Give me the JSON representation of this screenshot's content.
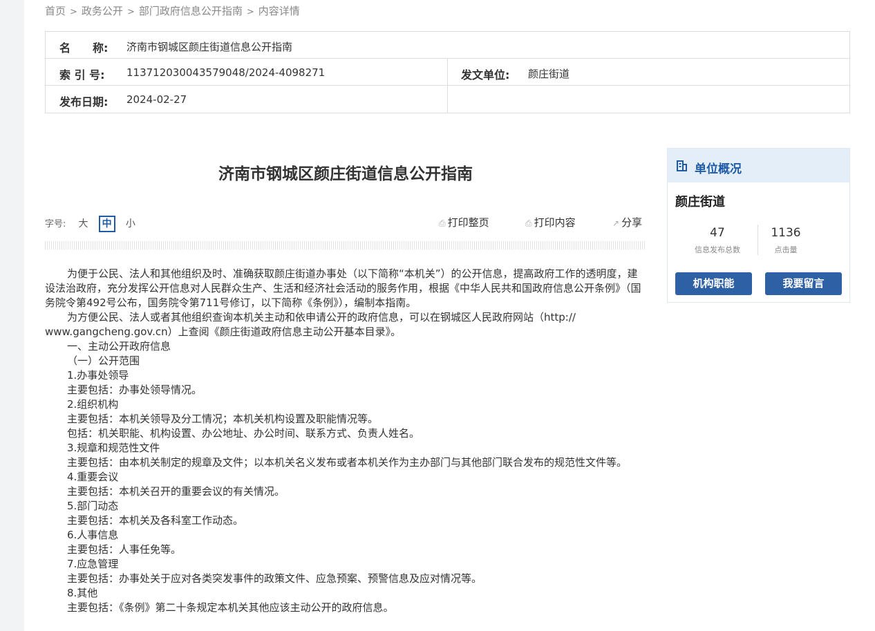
{
  "breadcrumb": [
    "首页",
    "政务公开",
    "部门政府信息公开指南",
    "内容详情"
  ],
  "breadcrumb_sep": ">",
  "meta": {
    "name_label": "名　　称:",
    "name_value": "济南市钢城区颜庄街道信息公开指南",
    "index_label": "索 引 号:",
    "index_value": "113712030043579048/2024-4098271",
    "unit_label": "发文单位:",
    "unit_value": "颜庄街道",
    "date_label": "发布日期:",
    "date_value": "2024-02-27"
  },
  "article_title": "济南市钢城区颜庄街道信息公开指南",
  "font_size": {
    "label": "字号:",
    "large": "大",
    "medium": "中",
    "small": "小",
    "selected": "中"
  },
  "tools": {
    "print_page": "打印整页",
    "print_content": "打印内容",
    "share": "分享"
  },
  "content": [
    {
      "indent": true,
      "text": "为便于公民、法人和其他组织及时、准确获取颜庄街道办事处（以下简称“本机关”）的公开信息，提高政府工作的透明度，建设法治政府，充分发挥公开信息对人民群众生产、生活和经济社会活动的服务作用，根据《中华人民共和国政府信息公开条例》（国务院令第492号公布，国务院令第711号修订，以下简称《条例》），编制本指南。"
    },
    {
      "indent": true,
      "text": "为方便公民、法人或者其他组织查询本机关主动和依申请公开的政府信息，可以在钢城区人民政府网站（http:// www.gangcheng.gov.cn）上查阅《颜庄街道政府信息主动公开基本目录》。"
    },
    {
      "indent": true,
      "text": "一、主动公开政府信息"
    },
    {
      "indent": true,
      "text": "（一）公开范围"
    },
    {
      "indent": true,
      "text": "1.办事处领导"
    },
    {
      "indent": true,
      "text": "主要包括：办事处领导情况。"
    },
    {
      "indent": true,
      "text": "2.组织机构"
    },
    {
      "indent": true,
      "text": "主要包括：本机关领导及分工情况；本机关机构设置及职能情况等。"
    },
    {
      "indent": true,
      "text": "包括：机关职能、机构设置、办公地址、办公时间、联系方式、负责人姓名。"
    },
    {
      "indent": true,
      "text": "3.规章和规范性文件"
    },
    {
      "indent": true,
      "text": "主要包括：由本机关制定的规章及文件；以本机关名义发布或者本机关作为主办部门与其他部门联合发布的规范性文件等。"
    },
    {
      "indent": true,
      "text": "4.重要会议"
    },
    {
      "indent": true,
      "text": "主要包括：本机关召开的重要会议的有关情况。"
    },
    {
      "indent": true,
      "text": "5.部门动态"
    },
    {
      "indent": true,
      "text": "主要包括：本机关及各科室工作动态。"
    },
    {
      "indent": true,
      "text": "6.人事信息"
    },
    {
      "indent": true,
      "text": "主要包括：人事任免等。"
    },
    {
      "indent": true,
      "text": "7.应急管理"
    },
    {
      "indent": true,
      "text": "主要包括：办事处关于应对各类突发事件的政策文件、应急预案、预警信息及应对情况等。"
    },
    {
      "indent": true,
      "text": "8.其他"
    },
    {
      "indent": true,
      "text": "主要包括：《条例》第二十条规定本机关其他应该主动公开的政府信息。"
    }
  ],
  "sidebar": {
    "header": "单位概况",
    "org_name": "颜庄街道",
    "stats": [
      {
        "value": "47",
        "caption": "信息发布总数"
      },
      {
        "value": "1136",
        "caption": "点击量"
      }
    ],
    "buttons": [
      "机构职能",
      "我要留言"
    ]
  },
  "colors": {
    "accent": "#1e5aa8",
    "button": "#2d60a5",
    "sidebar_header_bg": "#e3eef9"
  }
}
